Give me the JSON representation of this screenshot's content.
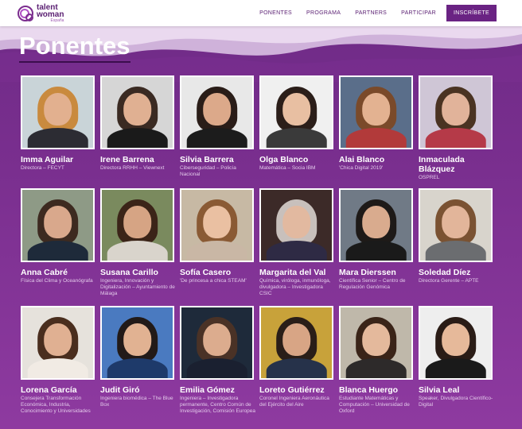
{
  "header": {
    "logo": {
      "line1": "talent",
      "line2": "woman",
      "line3": "España"
    },
    "nav": [
      "PONENTES",
      "PROGRAMA",
      "PARTNERS",
      "PARTICIPAR"
    ],
    "cta": "INSCRÍBETE"
  },
  "page": {
    "title": "Ponentes"
  },
  "speakers": [
    {
      "name": "Imma Aguilar",
      "role": "Directora – FECYT",
      "bg": "#c9d4d8",
      "skin": "#e2b08f",
      "hair": "#c98a3e",
      "cloth": "#2c2c33"
    },
    {
      "name": "Irene Barrena",
      "role": "Directora RRHH – Viewnext",
      "bg": "#d6d6d6",
      "skin": "#e0b092",
      "hair": "#3a2a22",
      "cloth": "#1a1a1a"
    },
    {
      "name": "Silvia Barrera",
      "role": "Ciberseguridad – Policía Nacional",
      "bg": "#e8e8e8",
      "skin": "#dca98a",
      "hair": "#2a1d18",
      "cloth": "#1c1c1c"
    },
    {
      "name": "Olga Blanco",
      "role": "Matemática – Socia IBM",
      "bg": "#f0f0f0",
      "skin": "#e8bfa2",
      "hair": "#2b1e19",
      "cloth": "#3a3a3a"
    },
    {
      "name": "Alai Blanco",
      "role": "'Chica Digital 2019'",
      "bg": "#5a6e8a",
      "skin": "#e3b291",
      "hair": "#7a4a2a",
      "cloth": "#b23a3a"
    },
    {
      "name": "Inmaculada Blázquez",
      "role": "OSPREL",
      "bg": "#cfc6d6",
      "skin": "#e1b39a",
      "hair": "#4a3322",
      "cloth": "#b53a48"
    },
    {
      "name": "Anna Cabré",
      "role": "Física del Clima y Oceanógrafa",
      "bg": "#8e9a86",
      "skin": "#d9a88c",
      "hair": "#3d2a20",
      "cloth": "#1e2a3a"
    },
    {
      "name": "Susana Carillo",
      "role": "Ingeniera, Innovación y Digitalización – Ayuntamiento de Málaga",
      "bg": "#7a8a5e",
      "skin": "#d6a484",
      "hair": "#3b2418",
      "cloth": "#d9d4cc"
    },
    {
      "name": "Sofía Casero",
      "role": "'De princesa a chica STEAM'",
      "bg": "#c7b9a4",
      "skin": "#eac0a2",
      "hair": "#8a5a34",
      "cloth": "#c9b7a5"
    },
    {
      "name": "Margarita del Val",
      "role": "Química, viróloga, inmunóloga, divulgadora – Investigadora CSIC",
      "bg": "#3c2a28",
      "skin": "#e2b9a0",
      "hair": "#c8c0bc",
      "cloth": "#2e2a44"
    },
    {
      "name": "Mara Dierssen",
      "role": "Científica Senior – Centro de Regulación Genómica",
      "bg": "#707a86",
      "skin": "#d9ab8e",
      "hair": "#1e1a18",
      "cloth": "#1a1a1a"
    },
    {
      "name": "Soledad Díez",
      "role": "Directora Gerente – APTE",
      "bg": "#d8d4cc",
      "skin": "#e2b59a",
      "hair": "#7a5232",
      "cloth": "#6b6d70"
    },
    {
      "name": "Lorena García",
      "role": "Consejera Transformación Económica, Industria, Conocimiento y Universidades",
      "bg": "#e6e2dc",
      "skin": "#e0b092",
      "hair": "#4a2e1e",
      "cloth": "#f1ebe4"
    },
    {
      "name": "Judit Giró",
      "role": "Ingeniera biomédica – The Blue Box",
      "bg": "#4a7ac0",
      "skin": "#e1b292",
      "hair": "#221a18",
      "cloth": "#1e3a6a"
    },
    {
      "name": "Emilia Gómez",
      "role": "Ingeniera – Investigadora permanente, Centro Común de Investigación, Comisión Europea",
      "bg": "#1e2a3a",
      "skin": "#dcac8e",
      "hair": "#4a3226",
      "cloth": "#1a2030"
    },
    {
      "name": "Loreto Gutiérrez",
      "role": "Coronel Ingeniera Aeronáutica del Ejército del Aire",
      "bg": "#c8a23a",
      "skin": "#d8a585",
      "hair": "#2a1e18",
      "cloth": "#26324a"
    },
    {
      "name": "Blanca Huergo",
      "role": "Estudiante Matemáticas y Computación – Universidad de Oxford",
      "bg": "#bfb8aa",
      "skin": "#e4b99c",
      "hair": "#3a2418",
      "cloth": "#2d2a2a"
    },
    {
      "name": "Silvia Leal",
      "role": "Speaker, Divulgadora Científico-Digital",
      "bg": "#eeeeee",
      "skin": "#e6b99a",
      "hair": "#2a1c16",
      "cloth": "#1a1a1a"
    }
  ]
}
